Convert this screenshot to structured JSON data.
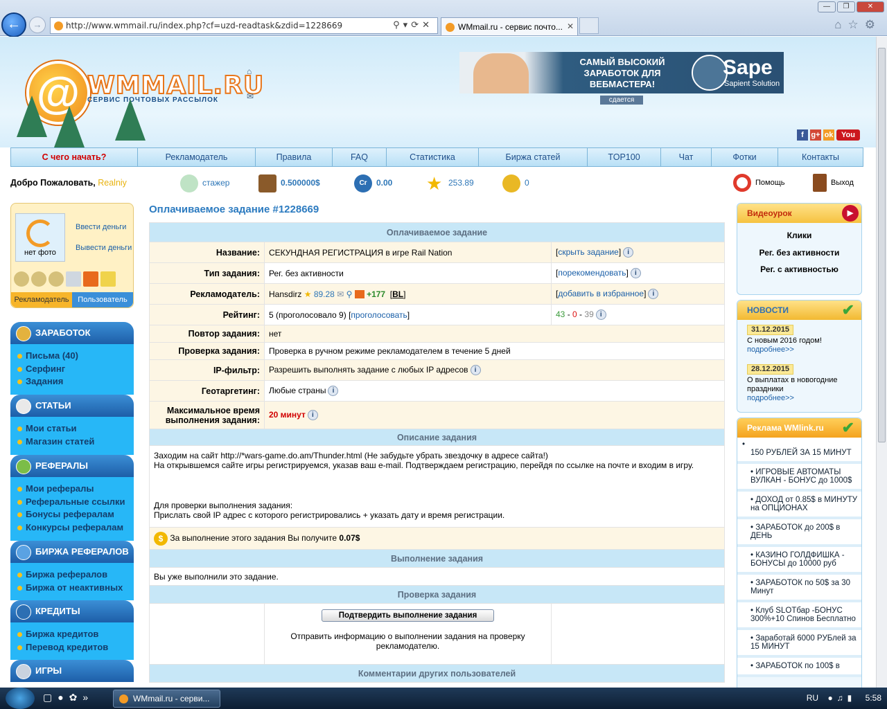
{
  "browser": {
    "url": "http://www.wmmail.ru/index.php?cf=uzd-readtask&zdid=1228669",
    "tab_title": "WMmail.ru - сервис почто...",
    "window_buttons": [
      "—",
      "❐",
      "✕"
    ]
  },
  "header": {
    "logo_name": "WMMAIL.RU",
    "logo_tagline": "СЕРВИС ПОЧТОВЫХ РАССЫЛОК",
    "banner_text": "САМЫЙ ВЫСОКИЙ ЗАРАБОТОК ДЛЯ ВЕБМАСТЕРА!",
    "banner_brand": "Sape",
    "banner_brand_sub": "Sapient Solution",
    "banner_label": "сдается",
    "social": [
      "f",
      "g+",
      "ok",
      "You"
    ]
  },
  "nav": [
    "С чего начать?",
    "Рекламодатель",
    "Правила",
    "FAQ",
    "Статистика",
    "Биржа статей",
    "TOP100",
    "Чат",
    "Фотки",
    "Контакты"
  ],
  "status": {
    "welcome": "Добро Пожаловать,",
    "username": "Realniy",
    "rank": "стажер",
    "balance": "0.500000$",
    "credits": "0.00",
    "rating": "253.89",
    "coins": "0",
    "help": "Помощь",
    "logout": "Выход"
  },
  "userbox": {
    "photo_label": "нет фото",
    "deposit": "Ввести деньги",
    "withdraw": "Вывести деньги",
    "tab_advertiser": "Рекламодатель",
    "tab_user": "Пользователь"
  },
  "menu": [
    {
      "title": "ЗАРАБОТОК",
      "items": [
        "Письма (40)",
        "Серфинг",
        "Задания"
      ]
    },
    {
      "title": "СТАТЬИ",
      "items": [
        "Мои статьи",
        "Магазин статей"
      ]
    },
    {
      "title": "РЕФЕРАЛЫ",
      "items": [
        "Мои рефералы",
        "Реферальные ссылки",
        "Бонусы рефералам",
        "Конкурсы рефералам"
      ]
    },
    {
      "title": "БИРЖА РЕФЕРАЛОВ",
      "items": [
        "Биржа рефералов",
        "Биржа от неактивных"
      ]
    },
    {
      "title": "КРЕДИТЫ",
      "items": [
        "Биржа кредитов",
        "Перевод кредитов"
      ]
    },
    {
      "title": "ИГРЫ",
      "items": []
    }
  ],
  "task": {
    "page_title": "Оплачиваемое задание #1228669",
    "section_main": "Оплачиваемое задание",
    "label_name": "Название:",
    "name": "СЕКУНДНАЯ РЕГИСТРАЦИЯ в игре Rail Nation",
    "hide_link": "скрыть задание",
    "label_type": "Тип задания:",
    "type": "Рег. без активности",
    "recommend_link": "порекомендовать",
    "label_advertiser": "Рекламодатель:",
    "advertiser": "Hansdirz",
    "advertiser_rating": "89.28",
    "advertiser_plus": "+177",
    "advertiser_bl": "BL",
    "favorite_link": "добавить в избранное",
    "label_rating": "Рейтинг:",
    "rating_text": "5 (проголосовало 9)",
    "vote_link": "проголосовать",
    "votes_pos": "43",
    "votes_zero": "0",
    "votes_neg": "39",
    "label_repeat": "Повтор задания:",
    "repeat": "нет",
    "label_check": "Проверка задания:",
    "check": "Проверка в ручном режиме рекламодателем в течение 5 дней",
    "label_ip": "IP-фильтр:",
    "ip": "Разрешить выполнять задание с любых IP адресов",
    "label_geo": "Геотаргетинг:",
    "geo": "Любые страны",
    "label_time": "Максимальное время выполнения задания:",
    "time": "20 минут",
    "section_desc": "Описание задания",
    "desc_line1": "Заходим на сайт http://*wars-game.do.am/Thunder.html (Не забудьте убрать звездочку в адресе сайта!)",
    "desc_line2": "На открывшемся сайте игры регистрируемся, указав ваш e-mail. Подтверждаем регистрацию, перейдя по ссылке на почте и входим в игру.",
    "check_line1": "Для проверки выполнения задания:",
    "check_line2": "Прислать свой IP адрес с которого регистрировались + указать дату и время регистрации.",
    "reward_text": "За выполнение этого задания Вы получите",
    "reward_amount": "0.07$",
    "section_exec": "Выполнение задания",
    "exec_text": "Вы уже выполнили это задание.",
    "section_verify": "Проверка задания",
    "confirm_button": "Подтвердить выполнение задания",
    "verify_text": "Отправить информацию о выполнении задания на проверку рекламодателю.",
    "section_comments": "Комментарии других пользователей"
  },
  "right": {
    "video_title": "Видеоурок",
    "video_links": [
      "Клики",
      "Рег. без активности",
      "Рег. с активностью"
    ],
    "news_title": "НОВОСТИ",
    "news": [
      {
        "date": "31.12.2015",
        "text": "С новым 2016 годом!",
        "more": "подробнее>>"
      },
      {
        "date": "28.12.2015",
        "text": "О выплатах в новогодние праздники",
        "more": "подробнее>>"
      }
    ],
    "ads_title": "Реклама WMlink.ru",
    "ads": [
      "150 РУБЛЕЙ ЗА 15 МИНУТ",
      "ИГРОВЫЕ АВТОМАТЫ ВУЛКАН - БОНУС до 1000$",
      "ДОХОД от 0.85$ в МИНУТУ на ОПЦИОНАХ",
      "ЗАРАБОТОК до 200$ в ДЕНЬ",
      "КАЗИНО ГОЛДФИШКА - БОНУСЫ до 10000 руб",
      "ЗАРАБОТОК по 50$ за 30 Минут",
      "Клуб SLOTбар -БОНУС 300%+10 Спинов Бесплатно",
      "Заработай 6000 РУБлей за 15 МИНУТ",
      "ЗАРАБОТОК по 100$ в"
    ]
  },
  "taskbar": {
    "task_title": "WMmail.ru - серви...",
    "lang": "RU",
    "time": "5:58"
  }
}
